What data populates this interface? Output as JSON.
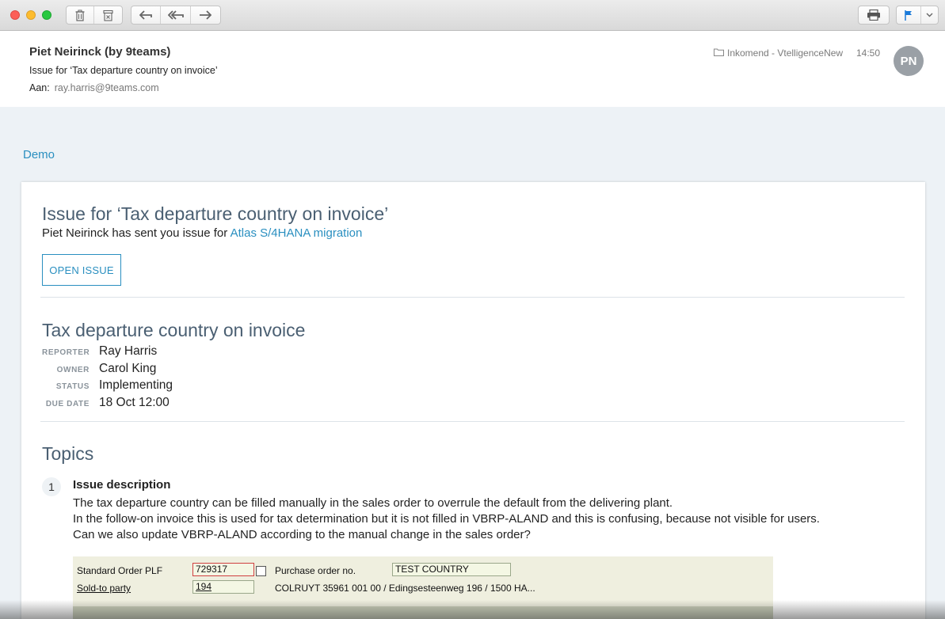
{
  "toolbar": {
    "buttons": [
      "trash-icon",
      "archive-icon",
      "reply-icon",
      "reply-all-icon",
      "forward-icon",
      "print-icon",
      "flag-icon",
      "chevron-down-icon"
    ]
  },
  "header": {
    "sender": "Piet Neirinck (by 9teams)",
    "subject": "Issue for ‘Tax departure country on invoice’",
    "to_label": "Aan:",
    "to_address": "ray.harris@9teams.com",
    "folder": "Inkomend - VtelligenceNew",
    "time": "14:50",
    "avatar_initials": "PN"
  },
  "body": {
    "demo_link": "Demo",
    "card": {
      "title": "Issue for ‘Tax departure country on invoice’",
      "subtitle_prefix": "Piet Neirinck has sent you issue for",
      "subtitle_link": "Atlas S/4HANA migration",
      "open_button": "OPEN ISSUE",
      "issue_title": "Tax departure country on invoice",
      "meta": [
        {
          "key": "REPORTER",
          "value": "Ray Harris"
        },
        {
          "key": "OWNER",
          "value": "Carol King"
        },
        {
          "key": "STATUS",
          "value": "Implementing"
        },
        {
          "key": "DUE DATE",
          "value": "18 Oct 12:00"
        }
      ],
      "topics_title": "Topics",
      "topic": {
        "number": "1",
        "heading": "Issue description",
        "lines": [
          "The tax departure country can be filled manually in the sales order to overrule the default from the delivering plant.",
          "In the follow-on invoice this is used for tax determination but it is not filled in VBRP-ALAND and this is confusing, because not visible for users.",
          "Can we also update VBRP-ALAND according to the manual change in the sales order?"
        ]
      },
      "sap": {
        "order_label": "Standard Order PLF",
        "order_value": "729317",
        "po_label": "Purchase order no.",
        "po_value": "TEST COUNTRY",
        "soldto_label": "Sold-to party",
        "soldto_value": "194",
        "soldto_text": "COLRUYT 35961 001 00 / Edingsesteenweg 196 / 1500 HA..."
      }
    }
  },
  "colors": {
    "accent": "#2a8fc0",
    "heading": "#4a5f72",
    "body_bg": "#edf2f6"
  }
}
